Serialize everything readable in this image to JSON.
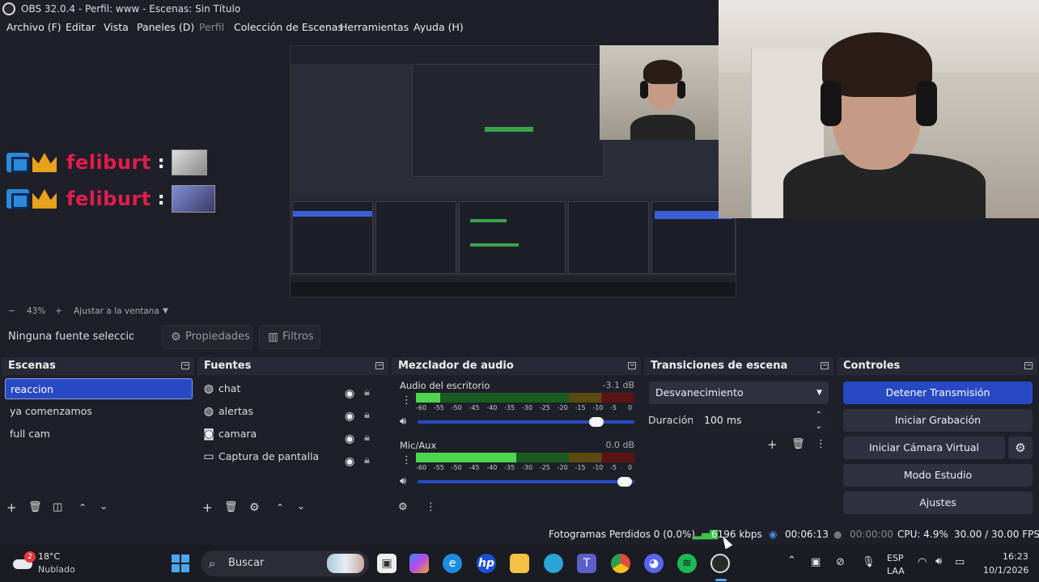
{
  "window": {
    "title": "OBS 32.0.4 - Perfil: www - Escenas: Sin Título"
  },
  "menu": [
    {
      "label": "Archivo (F)",
      "enabled": true
    },
    {
      "label": "Editar",
      "enabled": true
    },
    {
      "label": "Vista",
      "enabled": true
    },
    {
      "label": "Paneles (D)",
      "enabled": true
    },
    {
      "label": "Perfil",
      "enabled": false
    },
    {
      "label": "Colección de Escenas",
      "enabled": true
    },
    {
      "label": "Herramientas",
      "enabled": true
    },
    {
      "label": "Ayuda (H)",
      "enabled": true
    }
  ],
  "overlay": {
    "rows": [
      {
        "name": "feliburt",
        "colon": ":"
      },
      {
        "name": "feliburt",
        "colon": ":"
      }
    ]
  },
  "zoom": {
    "minus": "−",
    "value": "43%",
    "plus": "+",
    "fit": "Ajustar a la ventana"
  },
  "props": {
    "no_source": "Ninguna fuente seleccionada",
    "properties": "Propiedades",
    "filters": "Filtros"
  },
  "scenes": {
    "title": "Escenas",
    "items": [
      {
        "label": "reaccion",
        "selected": true
      },
      {
        "label": "ya comenzamos",
        "selected": false
      },
      {
        "label": "full cam",
        "selected": false
      }
    ]
  },
  "sources": {
    "title": "Fuentes",
    "items": [
      {
        "label": "chat",
        "icon": "browser-icon"
      },
      {
        "label": "alertas",
        "icon": "browser-icon"
      },
      {
        "label": "camara",
        "icon": "camera-icon"
      },
      {
        "label": "Captura de pantalla",
        "icon": "monitor-icon"
      }
    ]
  },
  "mixer": {
    "title": "Mezclador de audio",
    "scale": [
      "-60",
      "-55",
      "-50",
      "-45",
      "-40",
      "-35",
      "-30",
      "-25",
      "-20",
      "-15",
      "-10",
      "-5",
      "0"
    ],
    "channels": [
      {
        "name": "Audio del escritorio",
        "db": "-3.1 dB",
        "level": 0.11,
        "volume": 0.86
      },
      {
        "name": "Mic/Aux",
        "db": "0.0 dB",
        "level": 0.46,
        "volume": 0.99
      }
    ]
  },
  "transitions": {
    "title": "Transiciones de escena",
    "selected": "Desvanecimiento",
    "duration_label": "Duración",
    "duration_value": "100 ms"
  },
  "controls": {
    "title": "Controles",
    "buttons": [
      "Detener Transmisión",
      "Iniciar Grabación",
      "Iniciar Cámara Virtual",
      "Modo Estudio",
      "Ajustes"
    ]
  },
  "status": {
    "dropped": "Fotogramas Perdidos 0 (0.0%)",
    "kbps": "6196 kbps",
    "stream_time": "00:06:13",
    "rec_time": "00:00:00",
    "cpu": "CPU: 4.9%",
    "fps": "30.00 / 30.00 FPS"
  },
  "taskbar": {
    "weather_temp": "18°C",
    "weather_desc": "Nublado",
    "weather_badge": "2",
    "search": "Buscar",
    "lang": "ESP",
    "lang2": "LAA",
    "time": "16:23",
    "date": "10/1/2026"
  },
  "colors": {
    "accent": "#2849c4",
    "bg": "#1e1f29",
    "panel": "#272a36",
    "overlay_red": "#e21d4d"
  }
}
